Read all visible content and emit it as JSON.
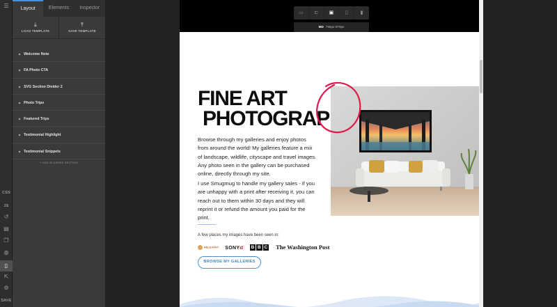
{
  "rail": {
    "css_label": "CSS",
    "js_label": "JS",
    "save_label": "SAVE"
  },
  "panel": {
    "tabs": [
      {
        "label": "Layout",
        "active": true
      },
      {
        "label": "Elements",
        "active": false
      },
      {
        "label": "Inspector",
        "active": false
      }
    ],
    "load_template": "LOAD TEMPLATE",
    "save_template": "SAVE TEMPLATE",
    "sections": [
      "Welcome Note",
      "FA Photo CTA",
      "SVG Section Divider 2",
      "Photo Trips",
      "Featured Trips",
      "Testimonial Highlight",
      "Testimonial Snippets"
    ],
    "add_section": "+ ADD SLASHED SECTION"
  },
  "devicebar": {
    "breakpoint_label": "MD",
    "breakpoint_range": "768px-979px",
    "devices": [
      "desktop-large-icon",
      "laptop-icon",
      "tablet-landscape-icon",
      "tablet-portrait-icon",
      "phone-icon"
    ],
    "active_device": 2
  },
  "content": {
    "title_line1": "FINE ART",
    "title_line2": "PHOTOGRAP",
    "para1": "Browse through my galleries and enjoy photos from around the world! My galleries feature a mix of landscape, wildlife, cityscape and travel images. Any photo seen in the gallery can be purchased online, directly through my site.",
    "para2": "I use Smugmug to handle my gallery sales - if you are unhappy with a print after receiving it, you can reach out to them within 30 days and they will reprint it or refund the amount you paid for the print.",
    "seen_label": "A few places my images have been seen in:",
    "logos": {
      "logo1": "RELEVANT",
      "sony": "SONY",
      "alpha": "α",
      "bbc": [
        "B",
        "B",
        "C"
      ],
      "wapo": "The Washington Post"
    },
    "cta_label": "BROWSE MY GALLERIES"
  },
  "colors": {
    "accent": "#4a90d9",
    "annotation": "#e0194a",
    "cta": "#3f84cf"
  }
}
